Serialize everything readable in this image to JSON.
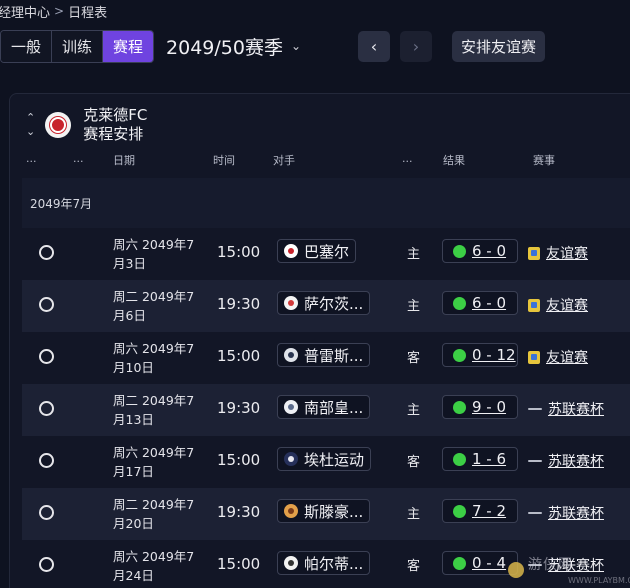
{
  "breadcrumb": {
    "parent": "经理中心",
    "separator": ">",
    "current": "日程表"
  },
  "toolbar": {
    "tabs": [
      {
        "label": "一般",
        "active": false
      },
      {
        "label": "训练",
        "active": false
      },
      {
        "label": "赛程",
        "active": true
      }
    ],
    "season": "2049/50赛季",
    "season_chevron": "⌄",
    "prev_icon": "‹",
    "next_icon": "›",
    "arrange_friendly": "安排友谊赛"
  },
  "club": {
    "name": "克莱德FC",
    "subtitle": "赛程安排",
    "caret_up": "⌃",
    "caret_down": "⌄"
  },
  "columns": {
    "c1": "...",
    "c2": "...",
    "date": "日期",
    "time": "时间",
    "opponent": "对手",
    "c6": "...",
    "result": "结果",
    "competition": "赛事"
  },
  "month": "2049年7月",
  "fixtures": [
    {
      "date": "周六 2049年7月3日",
      "time": "15:00",
      "opponent": "巴塞尔",
      "venue": "主",
      "result": "6 - 0",
      "competition": "友谊赛",
      "comp_type": "friendly",
      "badge_color": "#ffffff",
      "badge_dot": "#c8232c"
    },
    {
      "date": "周二 2049年7月6日",
      "time": "19:30",
      "opponent": "萨尔茨...",
      "venue": "主",
      "result": "6 - 0",
      "competition": "友谊赛",
      "comp_type": "friendly",
      "badge_color": "#f4f4f4",
      "badge_dot": "#d23a3a"
    },
    {
      "date": "周六 2049年7月10日",
      "time": "15:00",
      "opponent": "普雷斯...",
      "venue": "客",
      "result": "0 - 12",
      "competition": "友谊赛",
      "comp_type": "friendly",
      "badge_color": "#dfe3ea",
      "badge_dot": "#2a3550"
    },
    {
      "date": "周二 2049年7月13日",
      "time": "19:30",
      "opponent": "南部皇...",
      "venue": "主",
      "result": "9 - 0",
      "competition": "苏联赛杯",
      "comp_type": "cup",
      "badge_color": "#eef0f4",
      "badge_dot": "#5a6a8a"
    },
    {
      "date": "周六 2049年7月17日",
      "time": "15:00",
      "opponent": "埃杜运动",
      "venue": "客",
      "result": "1 - 6",
      "competition": "苏联赛杯",
      "comp_type": "cup",
      "badge_color": "#26305a",
      "badge_dot": "#e8e8f0"
    },
    {
      "date": "周二 2049年7月20日",
      "time": "19:30",
      "opponent": "斯滕豪...",
      "venue": "主",
      "result": "7 - 2",
      "competition": "苏联赛杯",
      "comp_type": "cup",
      "badge_color": "#e2a04a",
      "badge_dot": "#7a3a18"
    },
    {
      "date": "周六 2049年7月24日",
      "time": "15:00",
      "opponent": "帕尔蒂...",
      "venue": "客",
      "result": "0 - 4",
      "competition": "苏联赛杯",
      "comp_type": "cup",
      "badge_color": "#f2f2f2",
      "badge_dot": "#333333"
    }
  ],
  "colors": {
    "accent": "#6f43e0",
    "win": "#3ccf45",
    "background": "#0e1220"
  },
  "watermark": {
    "text": "游侠网",
    "url": "WWW.PLAYBM.CC"
  }
}
